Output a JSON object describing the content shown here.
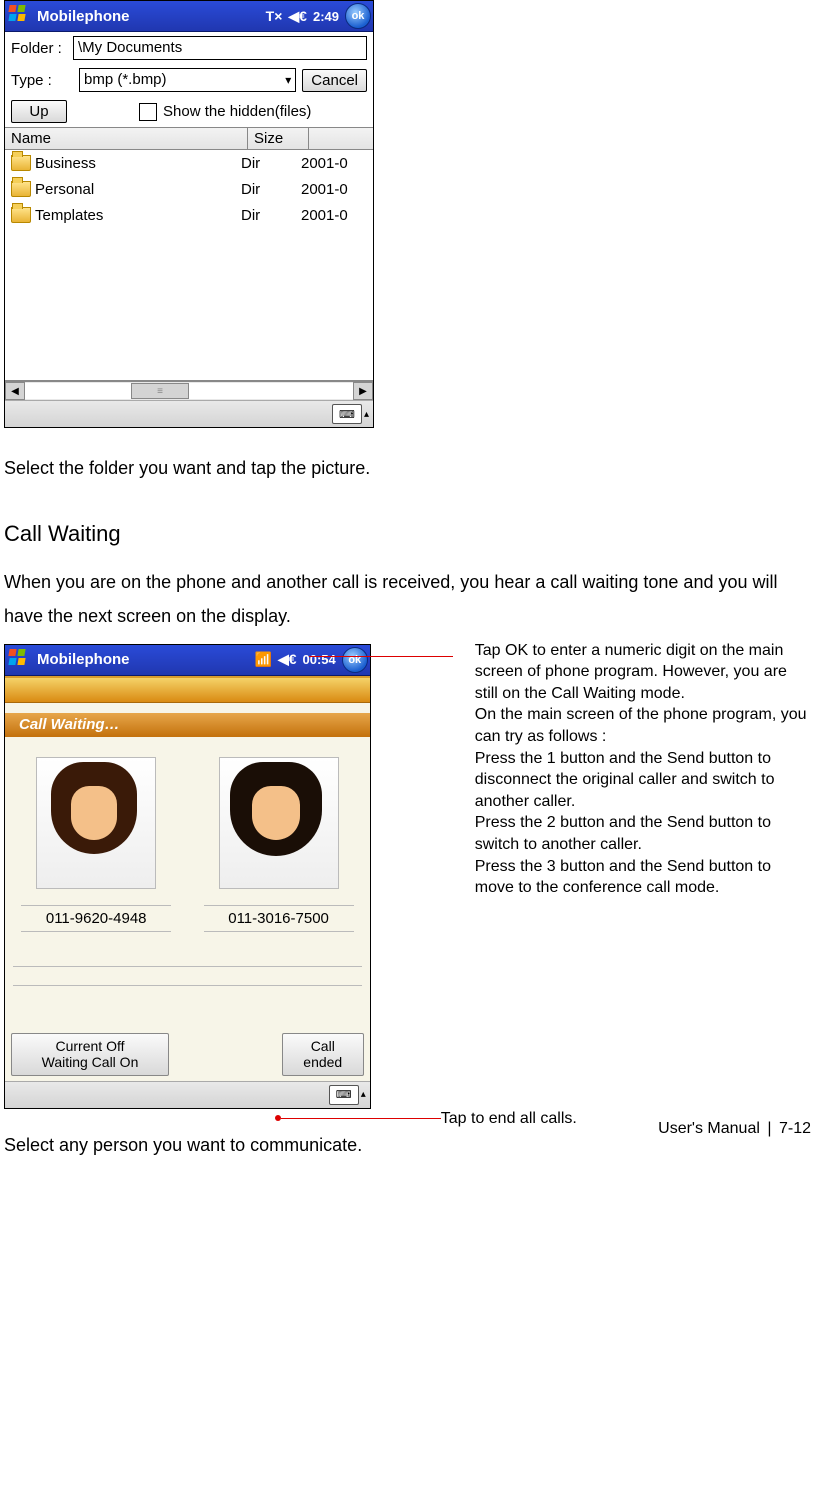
{
  "screenshot1": {
    "titlebar": {
      "title": "Mobilephone",
      "signal_icon": "T×",
      "sound_icon": "◀€",
      "time": "2:49",
      "ok_label": "ok"
    },
    "form": {
      "folder_label": "Folder :",
      "folder_value": "\\My Documents",
      "type_label": "Type :",
      "type_value": "bmp (*.bmp)",
      "cancel_label": "Cancel",
      "up_label": "Up",
      "show_hidden_label": "Show the hidden(files)"
    },
    "columns": {
      "name": "Name",
      "size": "Size",
      "date": ""
    },
    "files": [
      {
        "name": "Business",
        "size": "Dir",
        "date": "2001-0"
      },
      {
        "name": "Personal",
        "size": "Dir",
        "date": "2001-0"
      },
      {
        "name": "Templates",
        "size": "Dir",
        "date": "2001-0"
      }
    ]
  },
  "text": {
    "after_shot1": "Select the folder you want and tap the picture.",
    "heading": "Call Waiting",
    "para": "When you are on the phone and another call is received, you hear a call waiting tone and you will have the next screen on the display.",
    "after_shot2": "Select any person you want to communicate."
  },
  "screenshot2": {
    "titlebar": {
      "title": "Mobilephone",
      "signal_icon": "▮▯▯▮",
      "sound_icon": "◀€",
      "time": "00:54",
      "ok_label": "ok"
    },
    "status": "Call Waiting…",
    "callers": [
      {
        "number": "011-9620-4948"
      },
      {
        "number": "011-3016-7500"
      }
    ],
    "btn_left_line1": "Current Off",
    "btn_left_line2": "Waiting Call On",
    "btn_right_line1": "Call",
    "btn_right_line2": "ended"
  },
  "annotations": {
    "ok": "Tap OK to enter a numeric digit on the main screen of phone program. However, you are still on the Call Waiting mode.\nOn the main screen of the phone program, you can try as follows :\nPress the 1 button and the Send button to disconnect the original caller and switch to another caller.\nPress the 2 button and the Send button to switch to another caller.\nPress the 3 button and the Send button to move to the conference call mode.",
    "callended": "Tap to end all calls."
  },
  "footer": {
    "label": "User's Manual",
    "page": "7-12"
  }
}
